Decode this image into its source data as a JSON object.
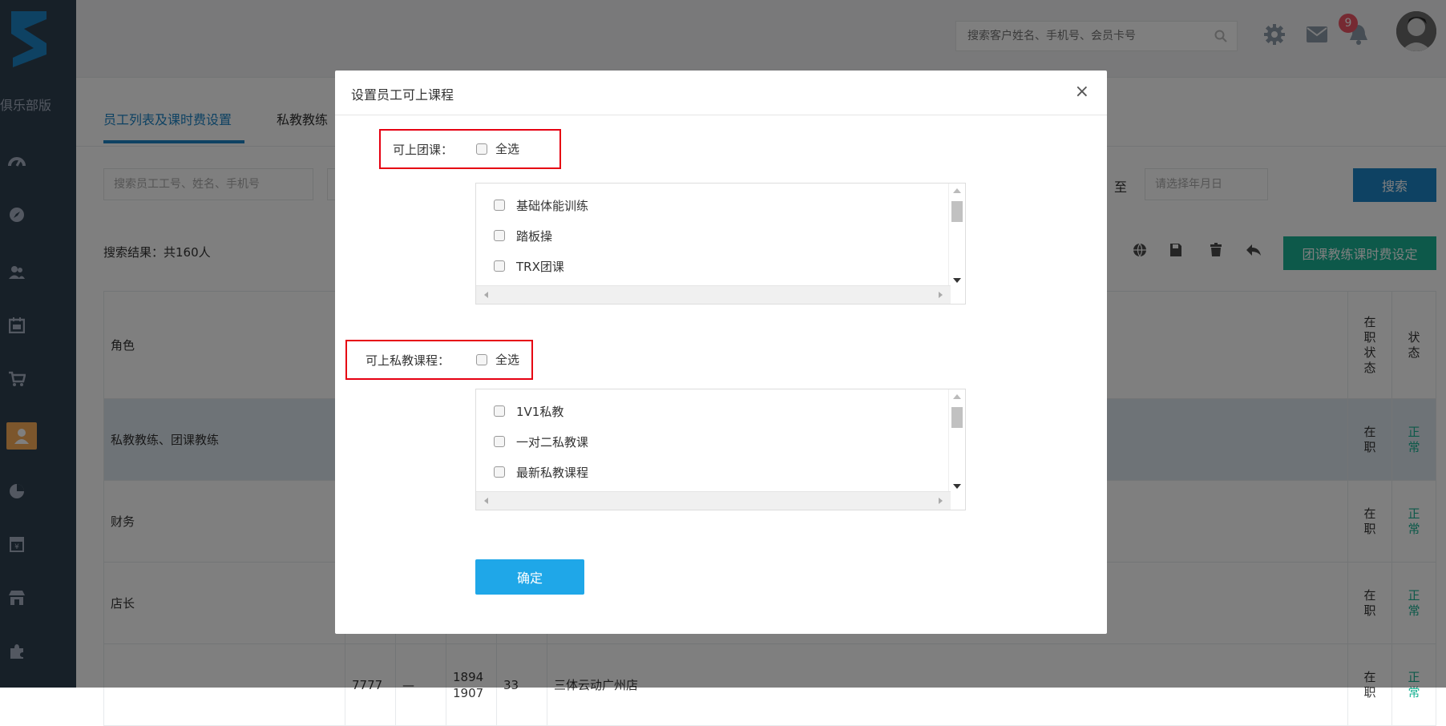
{
  "sidebar": {
    "brand": "俱乐部版",
    "icons": [
      "dashboard-icon",
      "compass-icon",
      "users-icon",
      "calendar-icon",
      "cart-icon",
      "user-icon",
      "pie-chart-icon",
      "finance-icon",
      "store-icon",
      "puzzle-icon"
    ]
  },
  "topbar": {
    "search_placeholder": "搜索客户姓名、手机号、会员卡号",
    "notification_count": "9"
  },
  "tabs": [
    {
      "label": "员工列表及课时费设置"
    },
    {
      "label": "私教教练"
    }
  ],
  "filters": {
    "keyword_placeholder": "搜索员工工号、姓名、手机号",
    "to_label": "至",
    "date_placeholder": "请选择年月日",
    "search_button": "搜索"
  },
  "result_text": "搜索结果：共160人",
  "toolbar": {
    "group_fee_button": "团课教练课时费设定"
  },
  "table": {
    "header_role": "角色",
    "header_status_job": "在职状态",
    "header_status": "状态",
    "rows": [
      {
        "role": "私教教练、团课教练",
        "job": "在职",
        "status": "正常"
      },
      {
        "role": "财务",
        "job": "在职",
        "status": "正常"
      },
      {
        "role": "店长",
        "job": "在职",
        "status": "正常"
      },
      {
        "role": "",
        "num1": "7777",
        "num2": "—",
        "num3": "1894",
        "num4": "1907",
        "num5": "33",
        "store": "三体云动广州店",
        "job": "在职",
        "status": "正常"
      }
    ]
  },
  "modal": {
    "title": "设置员工可上课程",
    "close": "×",
    "group_label": "可上团课：",
    "group_select_all": "全选",
    "group_courses": [
      "基础体能训练",
      "踏板操",
      "TRX团课"
    ],
    "private_label": "可上私教课程：",
    "private_select_all": "全选",
    "private_courses": [
      "1V1私教",
      "一对二私教课",
      "最新私教课程"
    ],
    "confirm_button": "确定"
  }
}
